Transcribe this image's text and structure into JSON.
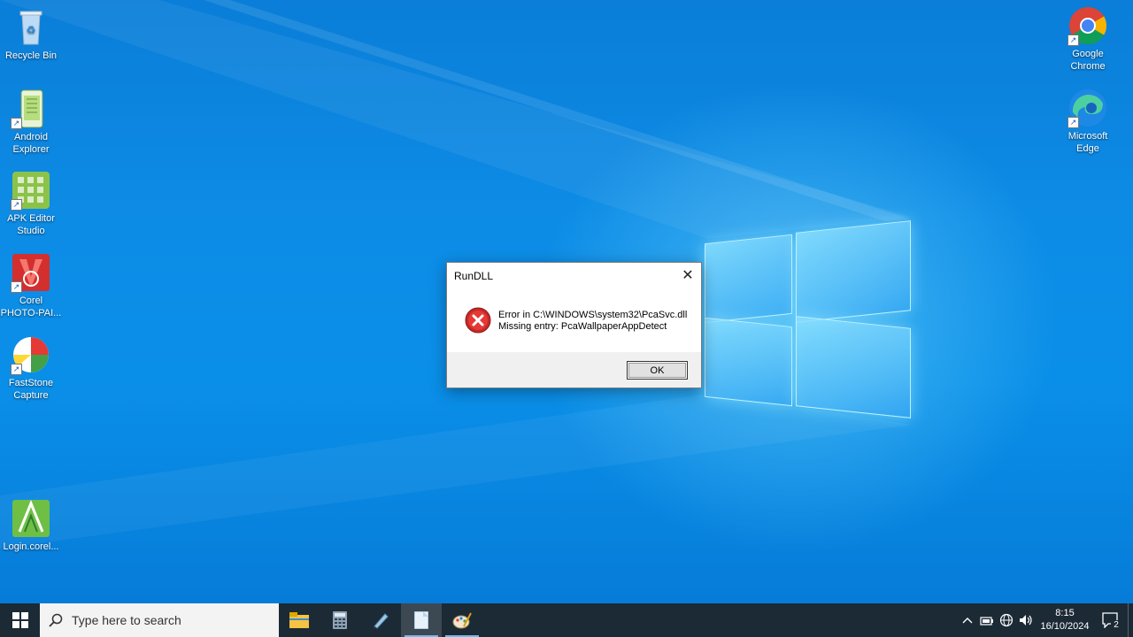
{
  "desktop": {
    "left_icons": [
      {
        "label": "Recycle Bin"
      },
      {
        "label": "Android Explorer"
      },
      {
        "label": "APK Editor Studio"
      },
      {
        "label": "Corel PHOTO-PAI..."
      },
      {
        "label": "FastStone Capture"
      },
      {
        "label": "Login.corel..."
      }
    ],
    "right_icons": [
      {
        "label": "Google Chrome"
      },
      {
        "label": "Microsoft Edge"
      }
    ]
  },
  "dialog": {
    "title": "RunDLL",
    "message_line1": "Error in C:\\WINDOWS\\system32\\PcaSvc.dll",
    "message_line2": "Missing entry: PcaWallpaperAppDetect",
    "ok_label": "OK",
    "close_glyph": "✕"
  },
  "taskbar": {
    "search_placeholder": "Type here to search",
    "apps": [
      "file-explorer-icon",
      "calculator-icon",
      "edit-app-icon",
      "notepad-icon",
      "paint-app-icon"
    ],
    "clock_time": "8:15",
    "clock_date": "16/10/2024",
    "notification_count": "2"
  },
  "colors": {
    "taskbar_bg": "#1c2a36",
    "accent": "#76b9ed",
    "error_red": "#d32f2f"
  }
}
